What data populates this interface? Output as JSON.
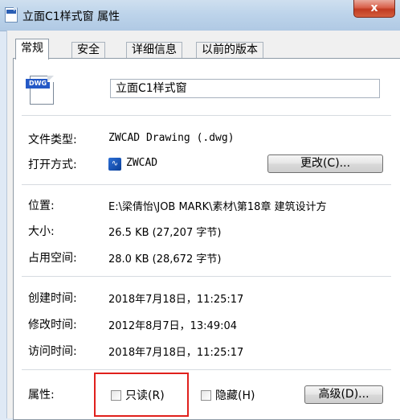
{
  "window": {
    "title": "立面C1样式窗 属性",
    "close_label": "x"
  },
  "tabs": [
    {
      "label": "常规",
      "active": true
    },
    {
      "label": "安全",
      "active": false
    },
    {
      "label": "详细信息",
      "active": false
    },
    {
      "label": "以前的版本",
      "active": false
    }
  ],
  "file": {
    "icon_badge": "DWG",
    "name": "立面C1样式窗"
  },
  "info": {
    "file_type_label": "文件类型:",
    "file_type_value": "ZWCAD Drawing (.dwg)",
    "open_with_label": "打开方式:",
    "open_with_value": "ZWCAD",
    "change_button": "更改(C)...",
    "location_label": "位置:",
    "location_value": "E:\\梁倩怡\\JOB MARK\\素材\\第18章  建筑设计方",
    "size_label": "大小:",
    "size_value": "26.5 KB (27,207 字节)",
    "size_on_disk_label": "占用空间:",
    "size_on_disk_value": "28.0 KB (28,672 字节)",
    "created_label": "创建时间:",
    "created_value": "2018年7月18日，11:25:17",
    "modified_label": "修改时间:",
    "modified_value": "2012年8月7日，13:49:04",
    "accessed_label": "访问时间:",
    "accessed_value": "2018年7月18日，11:25:17"
  },
  "attributes": {
    "label": "属性:",
    "readonly_label": "只读(R)",
    "readonly_checked": false,
    "hidden_label": "隐藏(H)",
    "hidden_checked": false,
    "advanced_button": "高级(D)..."
  },
  "colors": {
    "highlight": "#e0201c",
    "close_button": "#c03b22"
  },
  "icons": {
    "window_icon": "dwg-file-icon",
    "app_icon": "zwcad-icon"
  }
}
